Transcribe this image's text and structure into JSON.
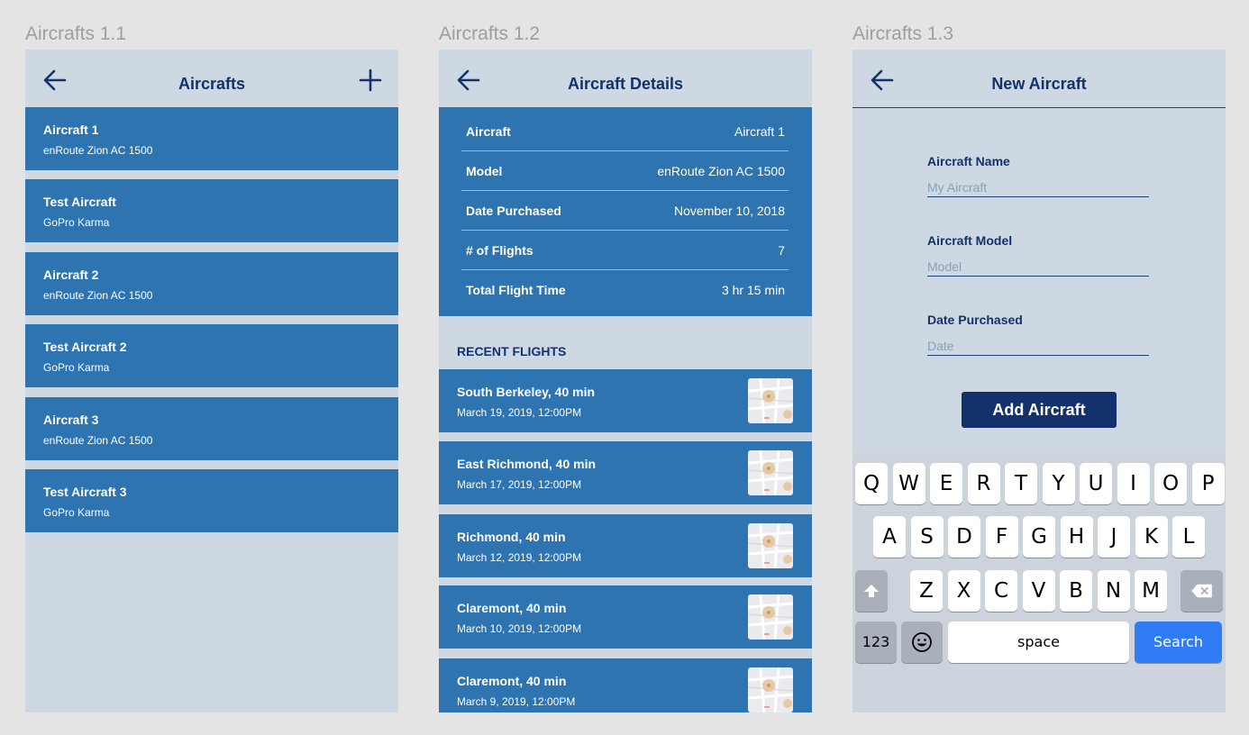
{
  "frames": [
    {
      "label": "Aircrafts 1.1"
    },
    {
      "label": "Aircrafts 1.2"
    },
    {
      "label": "Aircrafts 1.3"
    }
  ],
  "screen1": {
    "title": "Aircrafts",
    "icons": {
      "back": "arrow-left-icon",
      "add": "plus-icon"
    },
    "aircraft": [
      {
        "name": "Aircraft 1",
        "model": "enRoute Zion AC 1500"
      },
      {
        "name": "Test Aircraft",
        "model": "GoPro Karma"
      },
      {
        "name": "Aircraft 2",
        "model": "enRoute Zion AC 1500"
      },
      {
        "name": "Test Aircraft 2",
        "model": "GoPro Karma"
      },
      {
        "name": "Aircraft 3",
        "model": "enRoute Zion AC 1500"
      },
      {
        "name": "Test Aircraft 3",
        "model": "GoPro Karma"
      }
    ]
  },
  "screen2": {
    "title": "Aircraft Details",
    "details": [
      {
        "key": "Aircraft",
        "value": "Aircraft 1"
      },
      {
        "key": "Model",
        "value": "enRoute Zion AC 1500"
      },
      {
        "key": "Date Purchased",
        "value": "November 10, 2018"
      },
      {
        "key": "# of Flights",
        "value": "7"
      },
      {
        "key": "Total Flight Time",
        "value": "3 hr 15 min"
      }
    ],
    "recent_heading": "RECENT FLIGHTS",
    "flights": [
      {
        "title": "South Berkeley, 40 min",
        "date": "March 19, 2019, 12:00PM"
      },
      {
        "title": "East Richmond, 40 min",
        "date": "March 17, 2019, 12:00PM"
      },
      {
        "title": "Richmond, 40 min",
        "date": "March 12, 2019, 12:00PM"
      },
      {
        "title": "Claremont, 40 min",
        "date": "March 10, 2019, 12:00PM"
      },
      {
        "title": "Claremont, 40 min",
        "date": "March 9, 2019, 12:00PM"
      }
    ]
  },
  "screen3": {
    "title": "New Aircraft",
    "fields": [
      {
        "label": "Aircraft Name",
        "placeholder": "My Aircraft"
      },
      {
        "label": "Aircraft Model",
        "placeholder": "Model"
      },
      {
        "label": "Date Purchased",
        "placeholder": "Date"
      }
    ],
    "add_button": "Add Aircraft",
    "keyboard": {
      "row1": [
        "Q",
        "W",
        "E",
        "R",
        "T",
        "Y",
        "U",
        "I",
        "O",
        "P"
      ],
      "row2": [
        "A",
        "S",
        "D",
        "F",
        "G",
        "H",
        "J",
        "K",
        "L"
      ],
      "row3": [
        "Z",
        "X",
        "C",
        "V",
        "B",
        "N",
        "M"
      ],
      "num_key": "123",
      "space_key": "space",
      "search_key": "Search",
      "accent": "#2f7cf6"
    }
  },
  "colors": {
    "navy": "#13326b",
    "tile_blue": "#2e74b0",
    "screen_bg": "#cdd8e3"
  }
}
